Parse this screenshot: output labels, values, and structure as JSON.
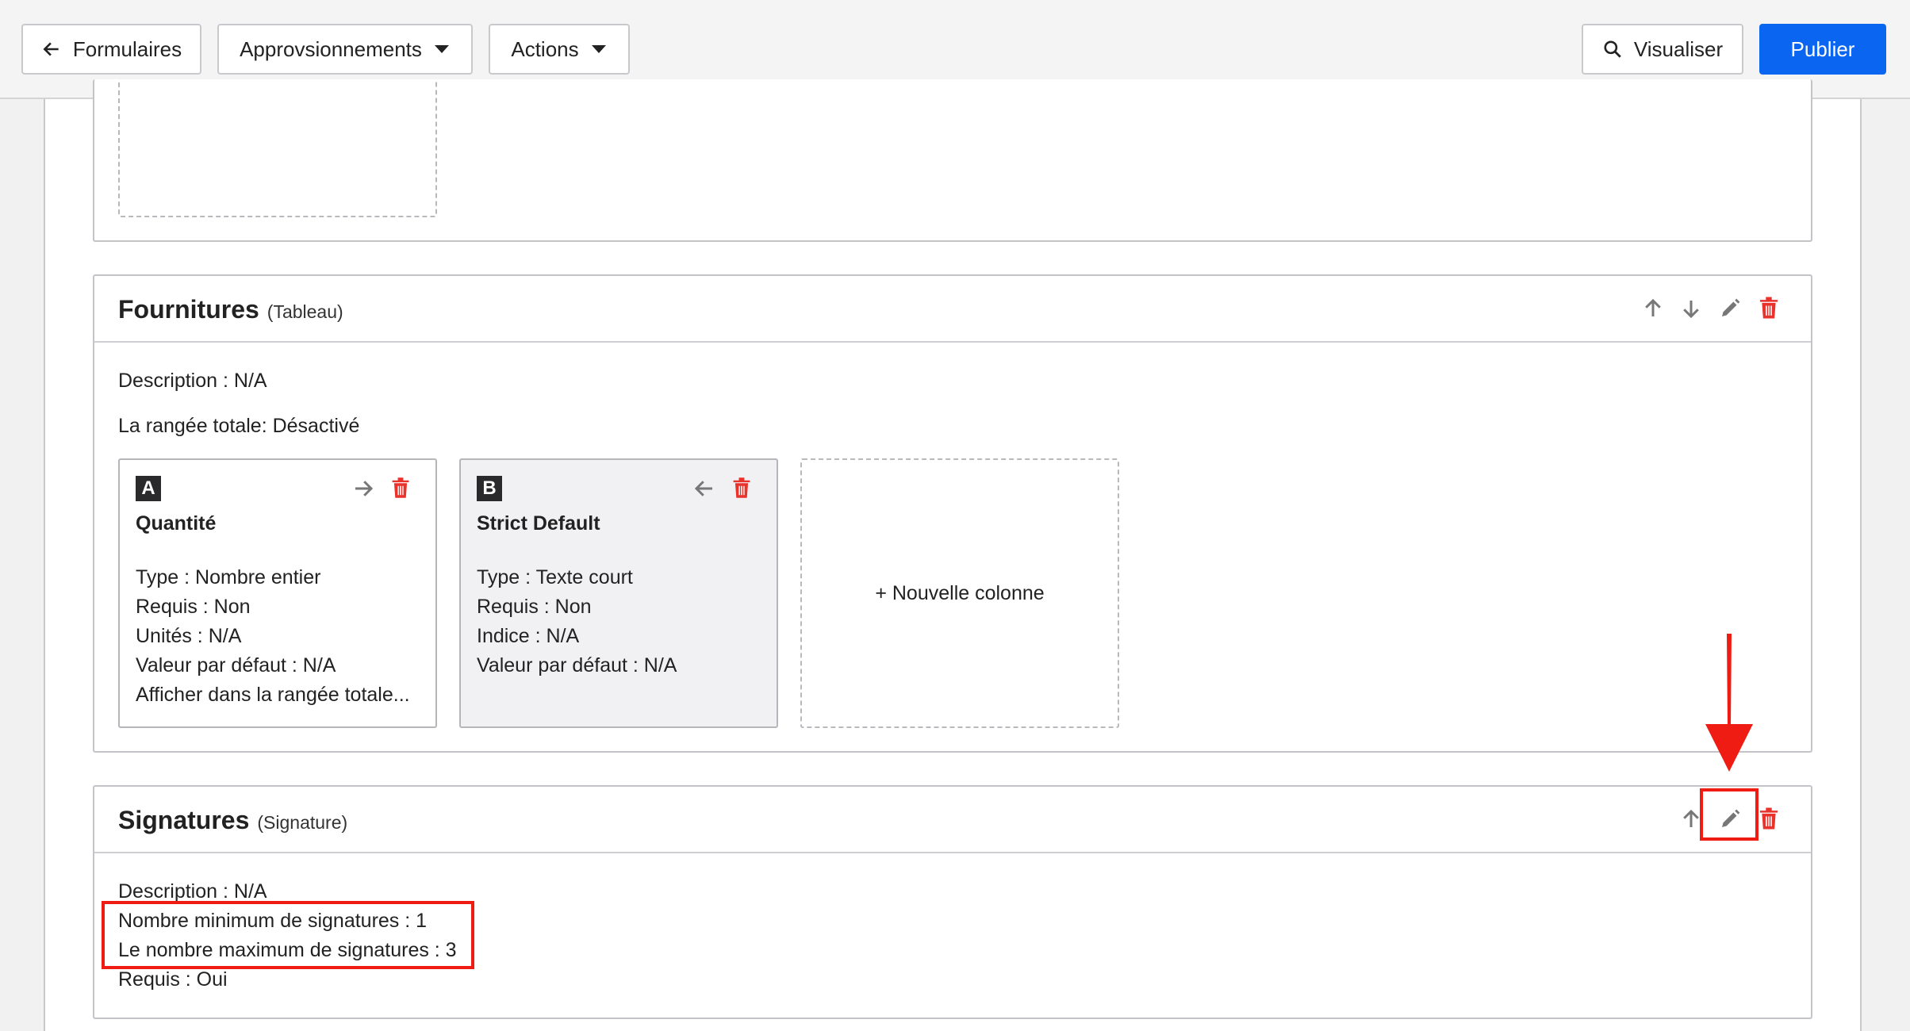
{
  "toolbar": {
    "back_label": "Formulaires",
    "approvisionnements_label": "Approvsionnements",
    "actions_label": "Actions",
    "visualiser_label": "Visualiser",
    "publier_label": "Publier"
  },
  "fournitures": {
    "title": "Fournitures",
    "type": "(Tableau)",
    "description": "Description : N/A",
    "total_row": "La rangée totale: Désactivé",
    "columns": [
      {
        "badge": "A",
        "title": "Quantité",
        "lines": [
          "Type : Nombre entier",
          "Requis : Non",
          "Unités : N/A",
          "Valeur par défaut : N/A",
          "Afficher dans la rangée totale..."
        ]
      },
      {
        "badge": "B",
        "title": "Strict Default",
        "lines": [
          "Type : Texte court",
          "Requis : Non",
          "Indice : N/A",
          "Valeur par défaut : N/A"
        ]
      }
    ],
    "new_column_label": "+ Nouvelle colonne"
  },
  "signatures": {
    "title": "Signatures",
    "type": "(Signature)",
    "description": "Description : N/A",
    "min": "Nombre minimum de signatures : 1",
    "max": "Le nombre maximum de signatures : 3",
    "required": "Requis : Oui"
  },
  "colors": {
    "accent": "#0a66f0",
    "delete": "#e8322b",
    "annotation": "#ee1c12"
  }
}
